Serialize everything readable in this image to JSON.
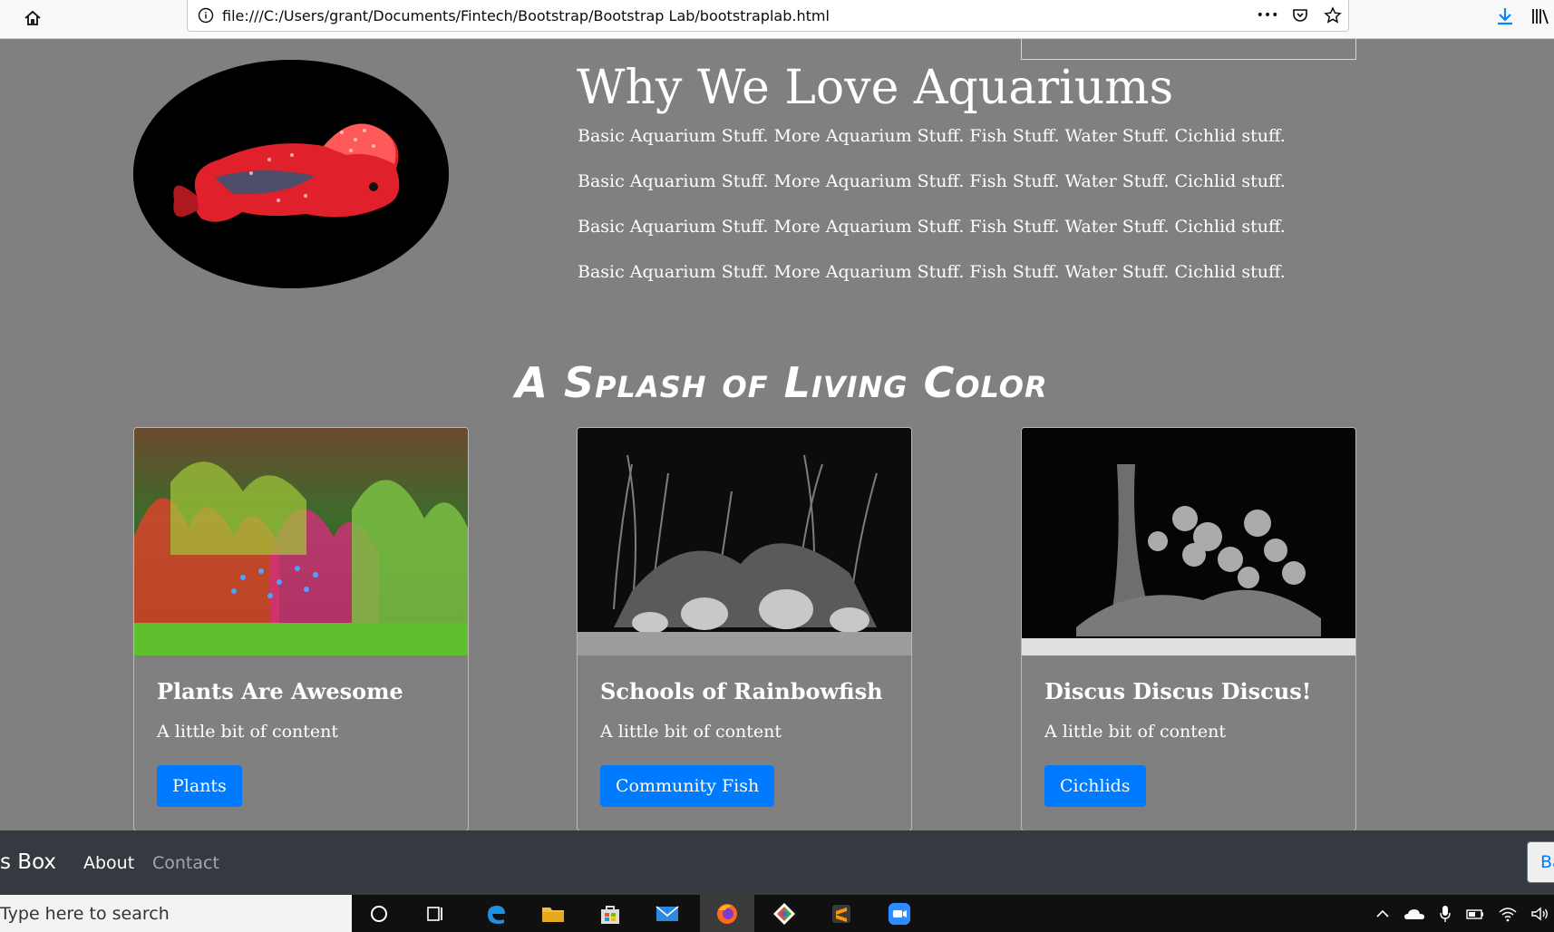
{
  "browser": {
    "url": "file:///C:/Users/grant/Documents/Fintech/Bootstrap/Bootstrap Lab/bootstraplab.html",
    "menu_dots": "•••"
  },
  "hero": {
    "title": "Why We Love Aquariums",
    "paragraphs": [
      "Basic Aquarium Stuff. More Aquarium Stuff. Fish Stuff. Water Stuff. Cichlid stuff.",
      "Basic Aquarium Stuff. More Aquarium Stuff. Fish Stuff. Water Stuff. Cichlid stuff.",
      "Basic Aquarium Stuff. More Aquarium Stuff. Fish Stuff. Water Stuff. Cichlid stuff.",
      "Basic Aquarium Stuff. More Aquarium Stuff. Fish Stuff. Water Stuff. Cichlid stuff."
    ]
  },
  "section": {
    "heading": "A Splash of Living Color"
  },
  "cards": [
    {
      "title": "Plants Are Awesome",
      "text": "A little bit of content",
      "button": "Plants"
    },
    {
      "title": "Schools of Rainbowfish",
      "text": "A little bit of content",
      "button": "Community Fish"
    },
    {
      "title": "Discus Discus Discus!",
      "text": "A little bit of content",
      "button": "Cichlids"
    }
  ],
  "navbar": {
    "brand": "s Box",
    "links": [
      "About",
      "Contact"
    ],
    "button_partial": "Ba"
  },
  "taskbar": {
    "search_placeholder": "Type here to search",
    "apps": [
      "cortana-circle",
      "task-view",
      "edge",
      "file-explorer",
      "store",
      "mail",
      "firefox",
      "git-tool",
      "sublime-text",
      "zoom"
    ]
  },
  "colors": {
    "page_bg": "#808080",
    "primary_button": "#007bff",
    "navbar_bg": "#343a40",
    "taskbar_bg": "#101010"
  }
}
